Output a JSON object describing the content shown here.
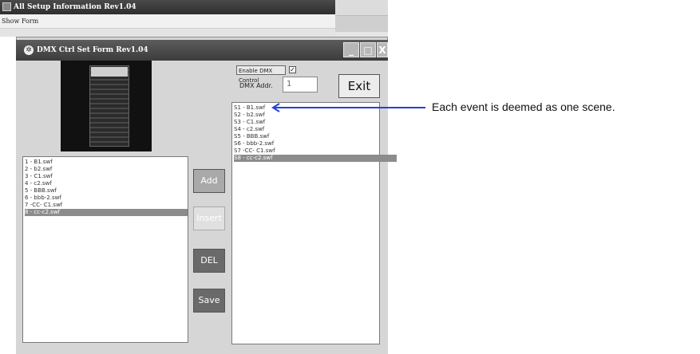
{
  "outer_window": {
    "title": "All Setup Information Rev1.04",
    "menu": "Show Form"
  },
  "dmx_window": {
    "title": "DMX Ctrl Set Form Rev1.04",
    "icon": "gear-icon",
    "minimize": "_",
    "maximize": "□",
    "close": "X"
  },
  "controls": {
    "enable_label": "Enable DMX Control",
    "enable_checked": "✓",
    "addr_label": "DMX Addr.",
    "addr_value": "1",
    "exit_label": "Exit"
  },
  "buttons": {
    "add": "Add",
    "insert": "Insert",
    "del": "DEL",
    "save": "Save"
  },
  "file_list": [
    "1 - B1.swf",
    "2 - b2.swf",
    "3 - C1.swf",
    "4 - c2.swf",
    "5 - BBB.swf",
    "6 - bbb-2.swf",
    "7 -CC- C1.swf",
    "8 - cc-c2.swf"
  ],
  "file_selected_index": 7,
  "scene_list": [
    "S1 - B1.swf",
    "S2 - b2.swf",
    "S3 - C1.swf",
    "S4 - c2.swf",
    "S5 - BBB.swf",
    "S6 - bbb-2.swf",
    "S7 -CC- C1.swf",
    "S8 - cc-c2.swf"
  ],
  "scene_selected_index": 7,
  "annotation": "Each event is deemed as one scene.",
  "colors": {
    "arrow": "#2440d8",
    "selection": "#8c8c8c"
  }
}
